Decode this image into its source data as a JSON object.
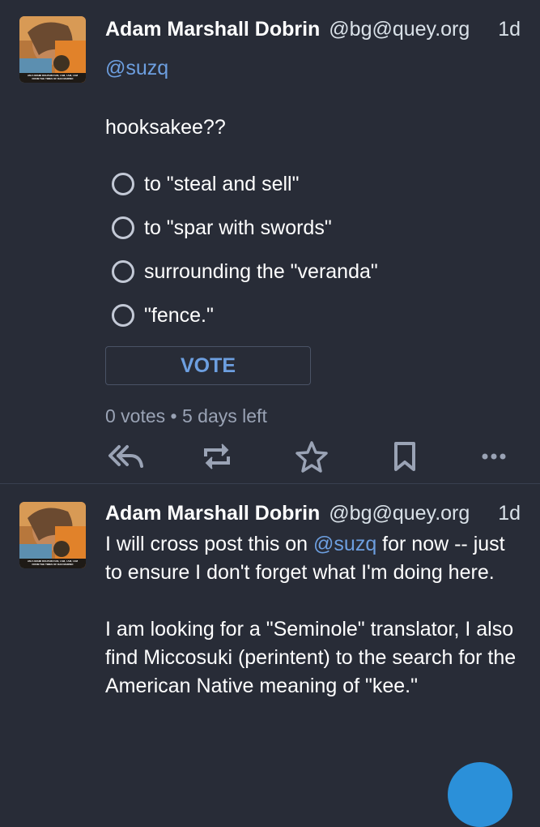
{
  "colors": {
    "background": "#282c37",
    "accent": "#6d9fe0",
    "muted": "#9aa3b5",
    "fab": "#2b90d9"
  },
  "posts": [
    {
      "display_name": "Adam Marshall Dobrin",
      "handle": "@bg@quey.org",
      "time": "1d",
      "avatar_caption_1": "AM A MIAMI DOLPHIN FAN, I AM, I AM, I AM",
      "avatar_caption_2": "FROM THE TIMES OF DAN MARINO",
      "mention": "@suzq",
      "text": "hooksakee??",
      "poll": {
        "options": [
          "to \"steal and sell\"",
          "to \"spar with swords\"",
          "surrounding the \"veranda\"",
          "\"fence.\""
        ],
        "vote_label": "VOTE",
        "votes": "0 votes",
        "separator": "•",
        "time_left": "5 days left"
      },
      "actions": [
        "reply-all-icon",
        "boost-icon",
        "star-icon",
        "bookmark-icon",
        "more-icon"
      ]
    },
    {
      "display_name": "Adam Marshall Dobrin",
      "handle": "@bg@quey.org",
      "time": "1d",
      "avatar_caption_1": "AM A MIAMI DOLPHIN FAN, I AM, I AM, I AM",
      "avatar_caption_2": "FROM THE TIMES OF DAN MARINO",
      "para1_before": "I will cross post this on ",
      "para1_mention": "@suzq",
      "para1_after": " for now -- just to ensure I don't forget what I'm doing here.",
      "para2": "I am looking for a \"Seminole\" translator, I also find Miccosuki (perintent) to the search for the American Native meaning of \"kee.\""
    }
  ]
}
